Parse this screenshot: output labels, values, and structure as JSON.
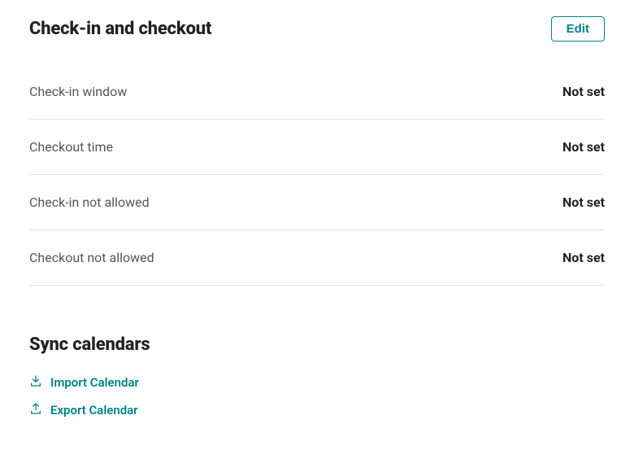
{
  "checkinSection": {
    "title": "Check-in and checkout",
    "editLabel": "Edit",
    "rows": [
      {
        "label": "Check-in window",
        "value": "Not set"
      },
      {
        "label": "Checkout time",
        "value": "Not set"
      },
      {
        "label": "Check-in not allowed",
        "value": "Not set"
      },
      {
        "label": "Checkout not allowed",
        "value": "Not set"
      }
    ]
  },
  "syncSection": {
    "title": "Sync calendars",
    "importLabel": "Import Calendar",
    "exportLabel": "Export Calendar"
  }
}
